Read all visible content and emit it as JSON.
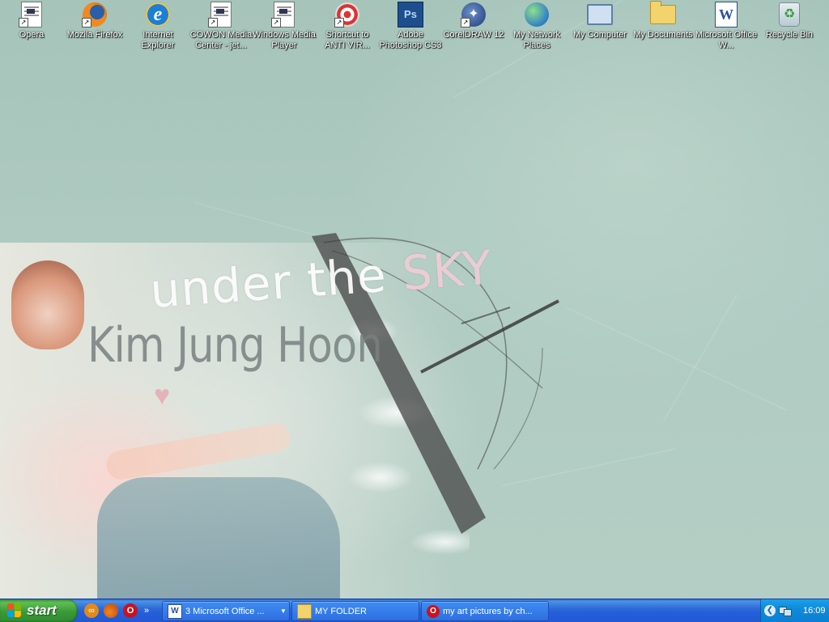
{
  "desktop": {
    "icons": [
      {
        "label": "Opera",
        "icon": "opera-page-icon"
      },
      {
        "label": "Mozila Firefox",
        "icon": "firefox-icon"
      },
      {
        "label": "Internet Explorer",
        "icon": "internet-explorer-icon"
      },
      {
        "label": "COWON Media Center - jet...",
        "icon": "cowon-page-icon"
      },
      {
        "label": "Windows Media Player",
        "icon": "media-player-page-icon"
      },
      {
        "label": "Shortcut to ANTI VIR...",
        "icon": "antivir-icon"
      },
      {
        "label": "Adobe Photoshop CS3",
        "icon": "photoshop-icon"
      },
      {
        "label": "CorelDRAW 12",
        "icon": "coreldraw-icon"
      },
      {
        "label": "My Network Places",
        "icon": "network-places-icon"
      },
      {
        "label": "My Computer",
        "icon": "computer-icon"
      },
      {
        "label": "My Documents",
        "icon": "documents-folder-icon"
      },
      {
        "label": "Microsoft Office W...",
        "icon": "word-icon"
      },
      {
        "label": "Recycle Bin",
        "icon": "recycle-bin-icon"
      }
    ],
    "wallpaper": {
      "tagline_prefix": "under the ",
      "tagline_highlight": "SKY",
      "name": "Kim Jung Hoon"
    }
  },
  "taskbar": {
    "start_label": "start",
    "quick_launch": [
      "quicklaunch-app-icon",
      "firefox-icon",
      "opera-icon"
    ],
    "quick_launch_more": "»",
    "tasks": [
      {
        "label": "3 Microsoft Office ...",
        "icon": "word-icon",
        "grouped": true
      },
      {
        "label": "MY FOLDER",
        "icon": "folder-icon",
        "grouped": false
      },
      {
        "label": "my art pictures by ch...",
        "icon": "opera-icon",
        "grouped": false
      }
    ],
    "clock": "16:09"
  },
  "colors": {
    "taskbar_blue": "#245edb",
    "start_green": "#3a9a37",
    "tray_blue": "#0f8bdc",
    "wallpaper_teal": "#a9c6bd"
  }
}
